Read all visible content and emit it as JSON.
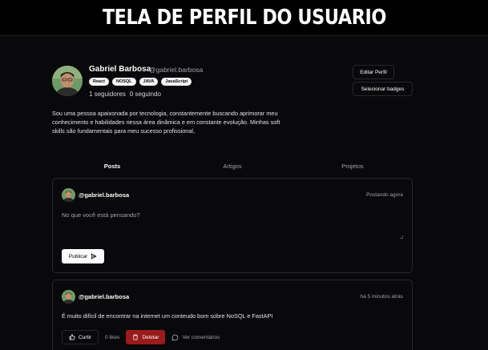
{
  "banner": {
    "title": "TELA DE PERFIL DO USUARIO"
  },
  "profile": {
    "name": "Gabriel Barbosa",
    "handle": "@gabriel.barbosa",
    "badges": [
      "React",
      "NOSQL",
      "JAVA",
      "JavaScript"
    ],
    "followers_count": "1",
    "followers_label": "seguidores",
    "following_count": "0",
    "following_label": "seguindo",
    "bio": "Sou uma pessoa apaixonada por tecnologia, constantemente buscando aprimorar meu conhecimento e habilidades nessa área dinâmica e em constante evolução. Minhas soft skills são fundamentais para meu sucesso profissional,"
  },
  "actions": {
    "edit_profile": "Editar Perfil",
    "select_badges": "Selecionar badges"
  },
  "tabs": [
    {
      "label": "Posts",
      "active": true
    },
    {
      "label": "Artigos",
      "active": false
    },
    {
      "label": "Projetos",
      "active": false
    }
  ],
  "composer": {
    "handle": "@gabriel.barbosa",
    "time": "Postando agora",
    "placeholder": "No que você está pensando?",
    "publish_label": "Publicar"
  },
  "post": {
    "handle": "@gabriel.barbosa",
    "time": "há 5 minutos atrás",
    "text": "É muito difícil de encontrar na internet um conteudo bom sobre NoSQL e FastAPI",
    "like_label": "Curtir",
    "likes": "0 likes",
    "delete_label": "Deletar",
    "comments_label": "Ver comentários"
  },
  "colors": {
    "background": "#09090b",
    "border": "#27272a",
    "danger": "#991b1b",
    "primary_button": "#fafafa"
  },
  "icons": [
    "send-icon",
    "thumbs-up-icon",
    "trash-icon",
    "message-circle-icon"
  ]
}
